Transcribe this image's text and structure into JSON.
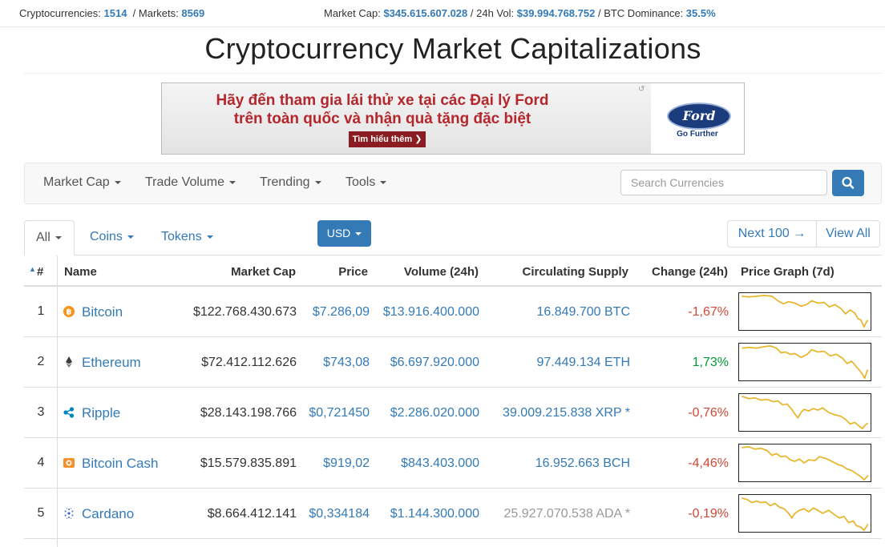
{
  "topbar": {
    "cryptocurrencies_label": "Cryptocurrencies:",
    "cryptocurrencies_value": "1514",
    "markets_label": "/ Markets:",
    "markets_value": "8569",
    "market_cap_label": "Market Cap:",
    "market_cap_value": "$345.615.607.028",
    "vol_label": "/ 24h Vol:",
    "vol_value": "$39.994.768.752",
    "dominance_label": "/ BTC Dominance:",
    "dominance_value": "35.5%"
  },
  "page_title": "Cryptocurrency Market Capitalizations",
  "ad": {
    "line1": "Hãy đến tham gia lái thử xe tại các Đại lý Ford",
    "line2": "trên toàn quốc và nhận quà tặng đặc biệt",
    "cta": "Tìm hiểu thêm ❯",
    "logo_text": "Ford",
    "tagline": "Go Further"
  },
  "nav": {
    "items": [
      "Market Cap",
      "Trade Volume",
      "Trending",
      "Tools"
    ],
    "search_placeholder": "Search Currencies"
  },
  "tabs": {
    "all": "All",
    "coins": "Coins",
    "tokens": "Tokens"
  },
  "currency": "USD",
  "pager": {
    "next": "Next 100 →",
    "view_all": "View All"
  },
  "table": {
    "headers": {
      "rank": "#",
      "name": "Name",
      "market_cap": "Market Cap",
      "price": "Price",
      "volume": "Volume (24h)",
      "supply": "Circulating Supply",
      "change": "Change (24h)",
      "graph": "Price Graph (7d)"
    },
    "rows": [
      {
        "rank": "1",
        "name": "Bitcoin",
        "market_cap": "$122.768.430.673",
        "price": "$7.286,09",
        "volume": "$13.916.400.000",
        "supply": "16.849.700 BTC",
        "change": "-1,67%",
        "icon_color": "#f7931a"
      },
      {
        "rank": "2",
        "name": "Ethereum",
        "market_cap": "$72.412.112.626",
        "price": "$743,08",
        "volume": "$6.697.920.000",
        "supply": "97.449.134 ETH",
        "change": "1,73%",
        "icon_color": "#3c3c3d"
      },
      {
        "rank": "3",
        "name": "Ripple",
        "market_cap": "$28.143.198.766",
        "price": "$0,721450",
        "volume": "$2.286.020.000",
        "supply": "39.009.215.838 XRP *",
        "change": "-0,76%",
        "icon_color": "#0085c0"
      },
      {
        "rank": "4",
        "name": "Bitcoin Cash",
        "market_cap": "$15.579.835.891",
        "price": "$919,02",
        "volume": "$843.403.000",
        "supply": "16.952.663 BCH",
        "change": "-4,46%",
        "icon_color": "#f58f29"
      },
      {
        "rank": "5",
        "name": "Cardano",
        "market_cap": "$8.664.412.141",
        "price": "$0,334184",
        "volume": "$1.144.300.000",
        "supply": "25.927.070.538 ADA *",
        "change": "-0,19%",
        "icon_color": "#3468d1"
      }
    ]
  },
  "colors": {
    "accent": "#337ab7",
    "negative": "#d14836",
    "positive": "#009933",
    "sparkline": "#e8b52a"
  },
  "icons": [
    "search-icon",
    "bitcoin-icon",
    "ethereum-icon",
    "ripple-icon",
    "bitcoin-cash-icon",
    "cardano-icon"
  ]
}
